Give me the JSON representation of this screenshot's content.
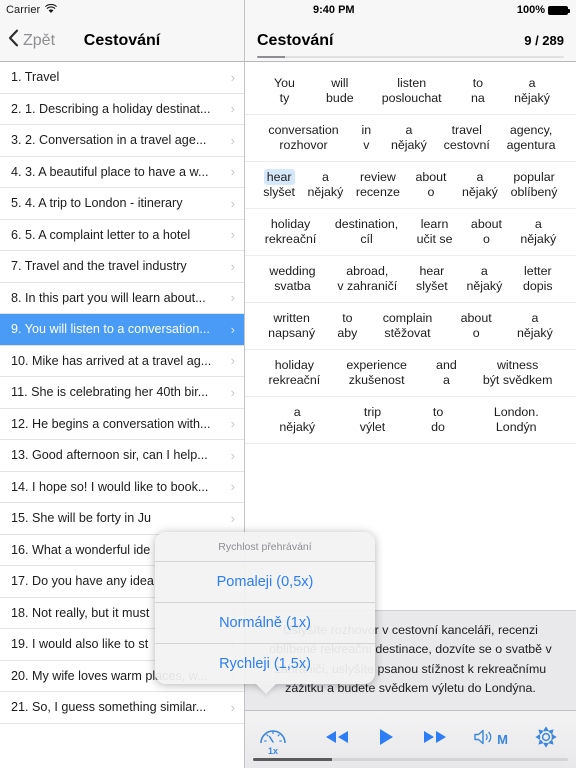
{
  "status_bar": {
    "carrier": "Carrier",
    "wifi_icon": "wifi-icon",
    "time": "9:40 PM",
    "battery_percent": "100%",
    "battery_icon": "battery-full-icon"
  },
  "sidebar": {
    "back_label": "Zpět",
    "back_icon": "chevron-left-icon",
    "title": "Cestování",
    "row_chevron_icon": "chevron-right-icon",
    "selected_index": 8,
    "items": [
      {
        "label": "1. Travel"
      },
      {
        "label": "2. 1. Describing a holiday destinat..."
      },
      {
        "label": "3. 2. Conversation in a travel age..."
      },
      {
        "label": "4. 3. A beautiful place to have a w..."
      },
      {
        "label": "5. 4. A trip to London - itinerary"
      },
      {
        "label": "6. 5. A complaint letter to a hotel"
      },
      {
        "label": "7. Travel and the travel industry"
      },
      {
        "label": "8. In this part you will learn about..."
      },
      {
        "label": "9. You will listen to a conversation..."
      },
      {
        "label": "10. Mike has arrived at a travel ag..."
      },
      {
        "label": "11. She is celebrating her 40th bir..."
      },
      {
        "label": "12. He begins a conversation with..."
      },
      {
        "label": "13. Good afternoon sir, can I help..."
      },
      {
        "label": "14. I hope so! I would like to book..."
      },
      {
        "label": "15. She will be forty in Ju"
      },
      {
        "label": "16. What a wonderful ide"
      },
      {
        "label": "17. Do you have any idea"
      },
      {
        "label": "18. Not really, but it must"
      },
      {
        "label": "19. I would also like to st"
      },
      {
        "label": "20. My wife loves warm places, w..."
      },
      {
        "label": "21. So, I guess something similar..."
      }
    ]
  },
  "detail": {
    "title": "Cestování",
    "counter": "9 / 289",
    "progress_percent": 9
  },
  "transcript": {
    "rows": [
      {
        "en": [
          "You",
          "will",
          "listen",
          "to",
          "a"
        ],
        "cs": [
          "ty",
          "bude",
          "poslouchat",
          "na",
          "nějaký"
        ],
        "highlight": -1
      },
      {
        "en": [
          "conversation",
          "in",
          "a",
          "travel",
          "agency,"
        ],
        "cs": [
          "rozhovor",
          "v",
          "nějaký",
          "cestovní",
          "agentura"
        ],
        "highlight": -1
      },
      {
        "en": [
          "hear",
          "a",
          "review",
          "about",
          "a",
          "popular"
        ],
        "cs": [
          "slyšet",
          "nějaký",
          "recenze",
          "o",
          "nějaký",
          "oblíbený"
        ],
        "highlight": 0
      },
      {
        "en": [
          "holiday",
          "destination,",
          "learn",
          "about",
          "a"
        ],
        "cs": [
          "rekreační",
          "cíl",
          "učit se",
          "o",
          "nějaký"
        ],
        "highlight": -1
      },
      {
        "en": [
          "wedding",
          "abroad,",
          "hear",
          "a",
          "letter"
        ],
        "cs": [
          "svatba",
          "v zahraničí",
          "slyšet",
          "nějaký",
          "dopis"
        ],
        "highlight": -1
      },
      {
        "en": [
          "written",
          "to",
          "complain",
          "about",
          "a"
        ],
        "cs": [
          "napsaný",
          "aby",
          "stěžovat",
          "o",
          "nějaký"
        ],
        "highlight": -1
      },
      {
        "en": [
          "holiday",
          "experience",
          "and",
          "witness"
        ],
        "cs": [
          "rekreační",
          "zkušenost",
          "a",
          "být svědkem"
        ],
        "highlight": -1
      },
      {
        "en": [
          "a",
          "trip",
          "to",
          "London."
        ],
        "cs": [
          "nějaký",
          "výlet",
          "do",
          "Londýn"
        ],
        "highlight": -1
      }
    ],
    "translation": "Uslyšíte rozhovor v cestovní kanceláři, recenzi oblíbené rekreační destinace, dozvíte se o svatbě v zahraničí, uslyšíte psanou stížnost k rekreačnímu zážitku a budete svědkem výletu do Londýna."
  },
  "toolbar": {
    "speed_icon": "speedometer-icon",
    "speed_value": "1x",
    "rewind_icon": "rewind-icon",
    "play_icon": "play-icon",
    "forward_icon": "fast-forward-icon",
    "speaker_icon": "speaker-wave-icon",
    "speaker_mode": "M",
    "settings_icon": "gear-icon",
    "play_progress_percent": 25
  },
  "speed_popover": {
    "title": "Rychlost přehrávání",
    "options": [
      {
        "label": "Pomaleji (0,5x)"
      },
      {
        "label": "Normálně (1x)"
      },
      {
        "label": "Rychleji (1,5x)"
      }
    ]
  },
  "colors": {
    "accent_blue": "#2d7df6",
    "selection_blue": "#4a9bf5",
    "word_highlight": "#d5e8f9",
    "icon_blue": "#3a86e0"
  }
}
